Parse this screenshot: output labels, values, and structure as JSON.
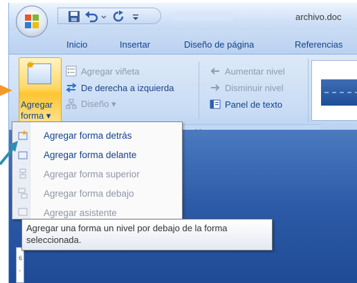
{
  "window": {
    "title": "archivo.doc"
  },
  "tabs": [
    {
      "label": "Inicio"
    },
    {
      "label": "Insertar"
    },
    {
      "label": "Diseño de página"
    },
    {
      "label": "Referencias"
    }
  ],
  "ribbon": {
    "add_shape_line1": "Agregar",
    "add_shape_line2": "forma ▾",
    "add_bullet": "Agregar viñeta",
    "right_to_left": "De derecha a izquierda",
    "layout": "Diseño ▾",
    "promote": "Aumentar nivel",
    "demote": "Disminuir nivel",
    "text_pane": "Panel de texto",
    "group_label_fragment": "co"
  },
  "menu": {
    "items": [
      {
        "label": "Agregar forma detrás",
        "enabled": true
      },
      {
        "label": "Agregar forma delante",
        "enabled": true
      },
      {
        "label": "Agregar forma superior",
        "enabled": false
      },
      {
        "label": "Agregar forma debajo",
        "enabled": false
      },
      {
        "label": "Agregar asistente",
        "enabled": false
      }
    ]
  },
  "tooltip": {
    "text": "Agregar una forma un nivel por debajo de la forma seleccionada."
  },
  "ruler": {
    "marks": [
      "6",
      "-"
    ]
  },
  "colors": {
    "ribbon_bg": "#c7dbf4",
    "accent_text": "#15428b",
    "highlight": "#ffc531",
    "arrow": "#f39a28",
    "arrow_teal": "#2f8fb0"
  },
  "icons": {
    "office_button": "office-logo-icon",
    "save": "save-icon",
    "undo": "undo-icon",
    "redo": "redo-icon",
    "qat_menu": "customize-qat-icon",
    "add_bullet": "bullet-list-icon",
    "right_to_left": "swap-arrows-icon",
    "layout": "org-chart-icon",
    "promote": "arrow-left-icon",
    "demote": "arrow-right-icon",
    "text_pane": "text-pane-icon"
  }
}
